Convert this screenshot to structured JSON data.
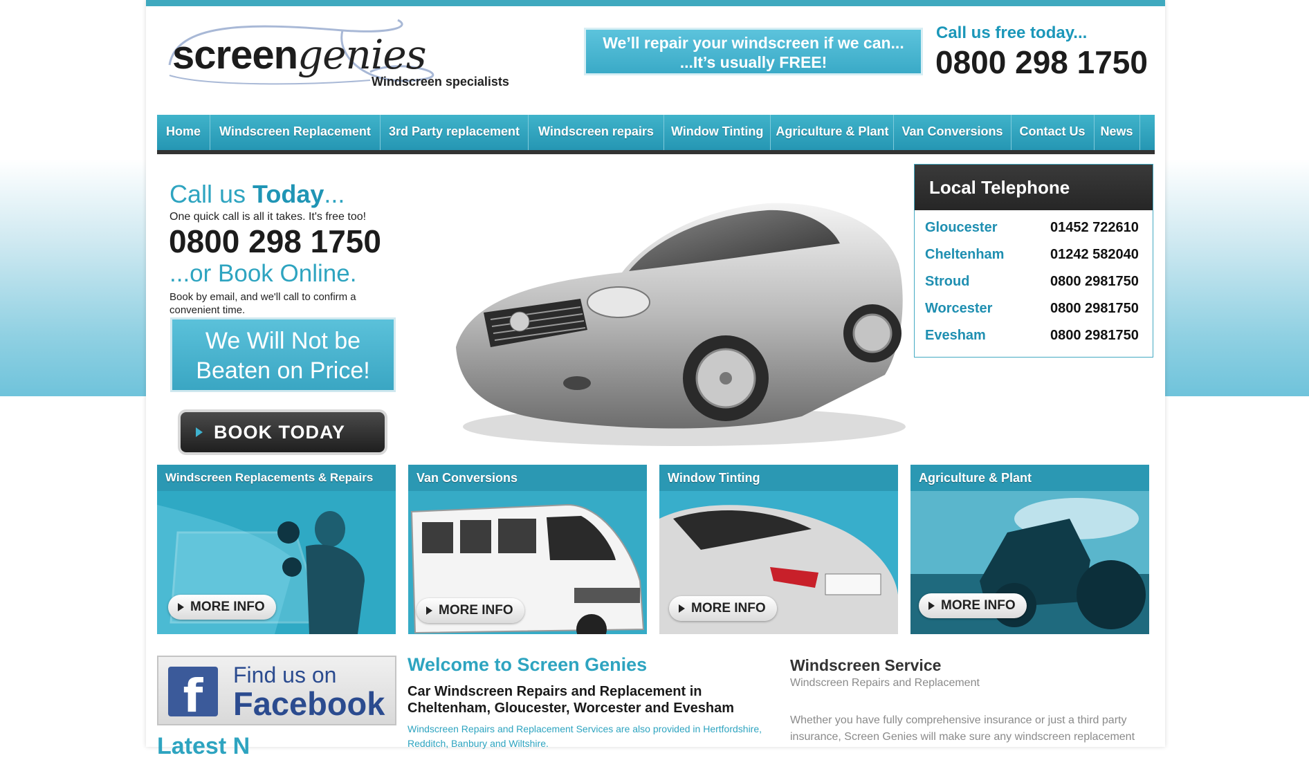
{
  "header": {
    "logo_word_a": "screen",
    "logo_word_b": "genies",
    "logo_tagline": "Windscreen specialists",
    "promo_line1": "We’ll repair your windscreen if we can...",
    "promo_line2": "...It’s usually FREE!",
    "call_free_label": "Call us free today...",
    "call_free_number": "0800 298 1750"
  },
  "nav": {
    "items": [
      {
        "label": "Home"
      },
      {
        "label": "Windscreen Replacement"
      },
      {
        "label": "3rd Party replacement"
      },
      {
        "label": "Windscreen repairs"
      },
      {
        "label": "Window Tinting"
      },
      {
        "label": "Agriculture & Plant"
      },
      {
        "label": "Van Conversions"
      },
      {
        "label": "Contact Us"
      },
      {
        "label": "News"
      }
    ]
  },
  "hero": {
    "call_prefix": "Call us ",
    "call_bold": "Today",
    "call_suffix": "...",
    "quick_text": "One quick call is all it takes. It's free too!",
    "number": "0800 298 1750",
    "book_online": "...or Book Online.",
    "book_text": "Book by email, and we'll call to confirm a convenient time.",
    "beaten_line1": "We Will Not be",
    "beaten_line2": "Beaten on Price!",
    "book_button": "BOOK TODAY"
  },
  "local_numbers": {
    "title": "Local Telephone Numbers",
    "rows": [
      {
        "town": "Gloucester",
        "tel": "01452 722610"
      },
      {
        "town": "Cheltenham",
        "tel": "01242 582040"
      },
      {
        "town": "Stroud",
        "tel": "0800 2981750"
      },
      {
        "town": "Worcester",
        "tel": "0800 2981750"
      },
      {
        "town": "Evesham",
        "tel": "0800 2981750"
      }
    ]
  },
  "services": [
    {
      "title": "Windscreen Replacements & Repairs",
      "more": "MORE INFO"
    },
    {
      "title": "Van Conversions",
      "more": "MORE INFO"
    },
    {
      "title": "Window Tinting",
      "more": "MORE INFO"
    },
    {
      "title": "Agriculture & Plant",
      "more": "MORE INFO"
    }
  ],
  "facebook": {
    "line1": "Find us on",
    "line2": "Facebook",
    "glyph": "f"
  },
  "latest_heading": "Latest N",
  "welcome": {
    "title": "Welcome to Screen Genies",
    "heading": "Car Windscreen Repairs and Replacement in Cheltenham, Gloucester, Worcester and Evesham",
    "also": "Windscreen Repairs and Replacement Services are also provided in Hertfordshire, Redditch, Banbury and Wiltshire."
  },
  "windscreen_service": {
    "title": "Windscreen Service",
    "subtitle": "Windscreen Repairs and Replacement",
    "body": "Whether you have fully comprehensive insurance or just a third party insurance, Screen Genies will make sure any windscreen replacement"
  },
  "colors": {
    "accent": "#2ea4c0",
    "nav": "#2596b3",
    "dark": "#262626"
  }
}
